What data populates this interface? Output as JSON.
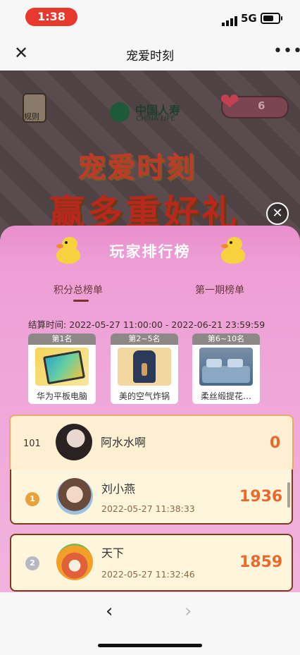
{
  "status_bar": {
    "time": "1:38",
    "network": "5G"
  },
  "nav": {
    "title": "宠爱时刻",
    "close_icon": "close-icon",
    "more_icon": "more-icon"
  },
  "banner": {
    "rules_label": "规则",
    "logo_cn": "中国人寿",
    "logo_en": "CHINA LIFE",
    "hearts": "6",
    "headline": "宠爱时刻",
    "subheadline": "赢多重好礼"
  },
  "sheet": {
    "title": "玩家排行榜",
    "tabs": [
      {
        "label": "积分总榜单",
        "active": true
      },
      {
        "label": "第一期榜单",
        "active": false
      }
    ],
    "settlement_label": "结算时间:",
    "settlement_range": "2022-05-27 11:00:00 - 2022-06-21 23:59:59",
    "prizes": [
      {
        "rank": "第1名",
        "name": "华为平板电脑"
      },
      {
        "rank": "第2~5名",
        "name": "美的空气炸锅"
      },
      {
        "rank": "第6~10名",
        "name": "柔丝缎提花…"
      }
    ],
    "my_entry": {
      "rank": "101",
      "name": "阿水水啊",
      "score": "0"
    },
    "leaderboard": [
      {
        "rank": "1",
        "name": "刘小燕",
        "time": "2022-05-27 11:38:33",
        "score": "1936",
        "medal_color": "#e9a23a"
      },
      {
        "rank": "2",
        "name": "天下",
        "time": "2022-05-27 11:32:46",
        "score": "1859",
        "medal_color": "#b8b8c0"
      }
    ]
  },
  "colors": {
    "accent": "#e96a2a",
    "sheet_pink": "#ee9fd6",
    "status_pill": "#e8392f"
  }
}
